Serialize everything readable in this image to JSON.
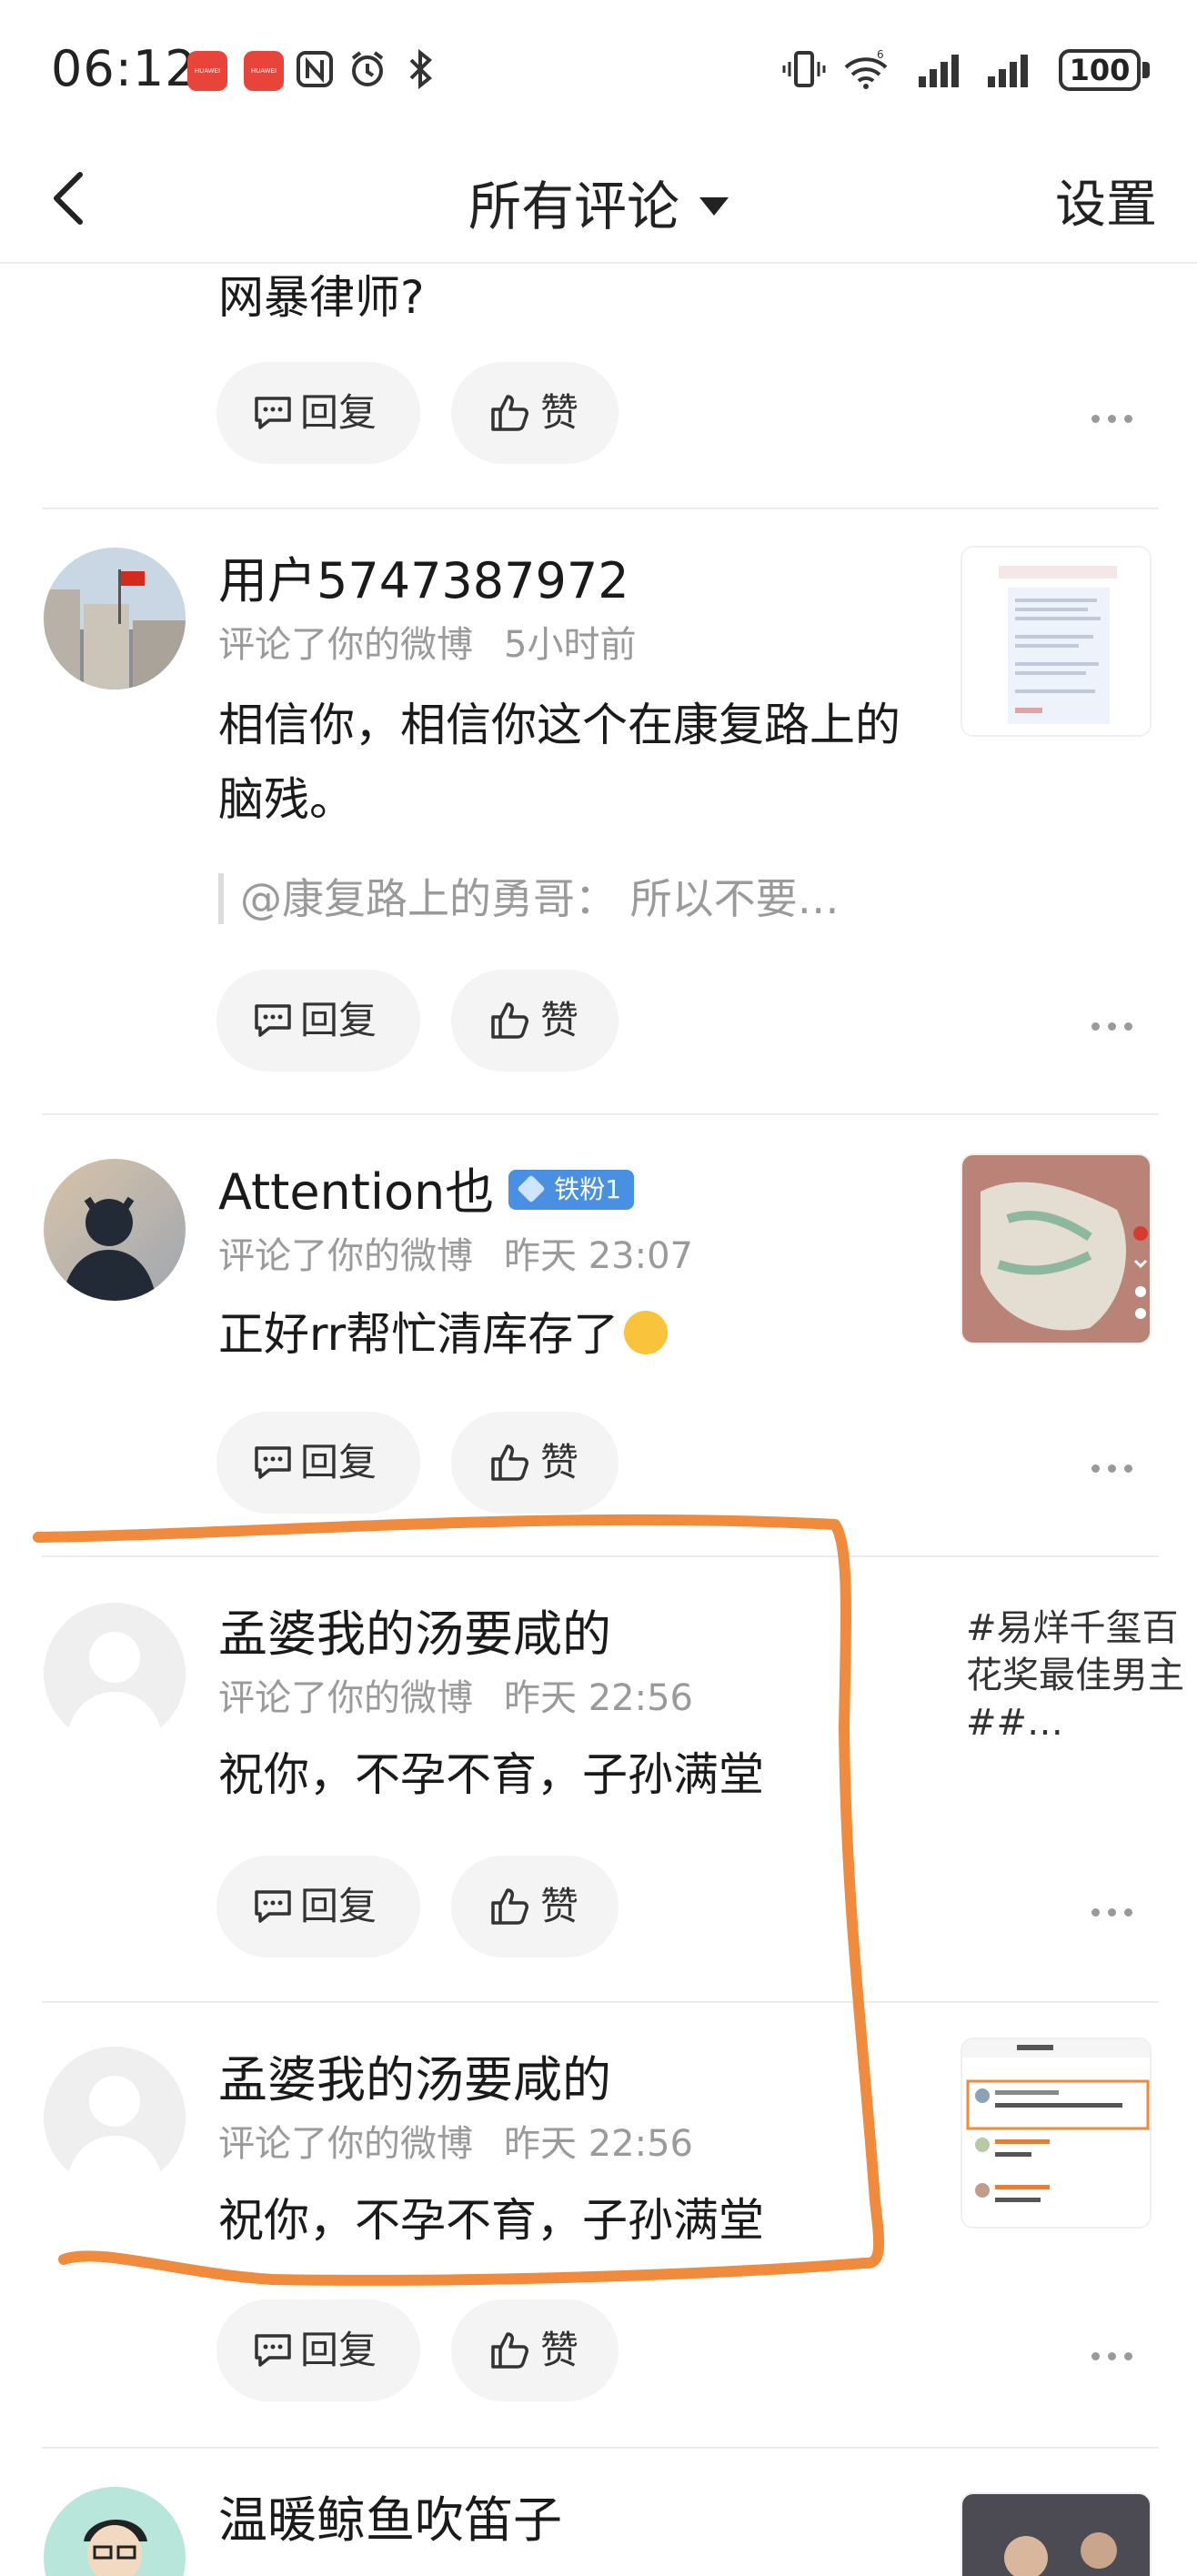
{
  "status_bar": {
    "time": "06:12",
    "app_badges": [
      "HUAWEI",
      "HUAWEI"
    ],
    "network_label": "6",
    "battery": "100"
  },
  "header": {
    "title": "所有评论",
    "settings_label": "设置"
  },
  "actions": {
    "reply_label": "回复",
    "like_label": "赞"
  },
  "comments": [
    {
      "content": "网暴律师?"
    },
    {
      "username": "用户5747387972",
      "action": "评论了你的微博",
      "time": "5小时前",
      "content": "相信你，相信你这个在康复路上的脑残。",
      "quote": "@康复路上的勇哥： 所以不要…"
    },
    {
      "username": "Attention也",
      "badge": "铁粉1",
      "action": "评论了你的微博",
      "time": "昨天 23:07",
      "content": "正好rr帮忙清库存了"
    },
    {
      "username": "孟婆我的汤要咸的",
      "action": "评论了你的微博",
      "time": "昨天 22:56",
      "content": "祝你，不孕不育，子孙满堂",
      "topic": "#易烊千玺百花奖最佳男主##…"
    },
    {
      "username": "孟婆我的汤要咸的",
      "action": "评论了你的微博",
      "time": "昨天 22:56",
      "content": "祝你，不孕不育，子孙满堂"
    },
    {
      "username": "温暖鲸鱼吹笛子"
    }
  ],
  "colors": {
    "annotation_stroke": "#f08a3c",
    "badge_blue": "#4a90e2",
    "meta_gray": "#9a9a9a"
  }
}
